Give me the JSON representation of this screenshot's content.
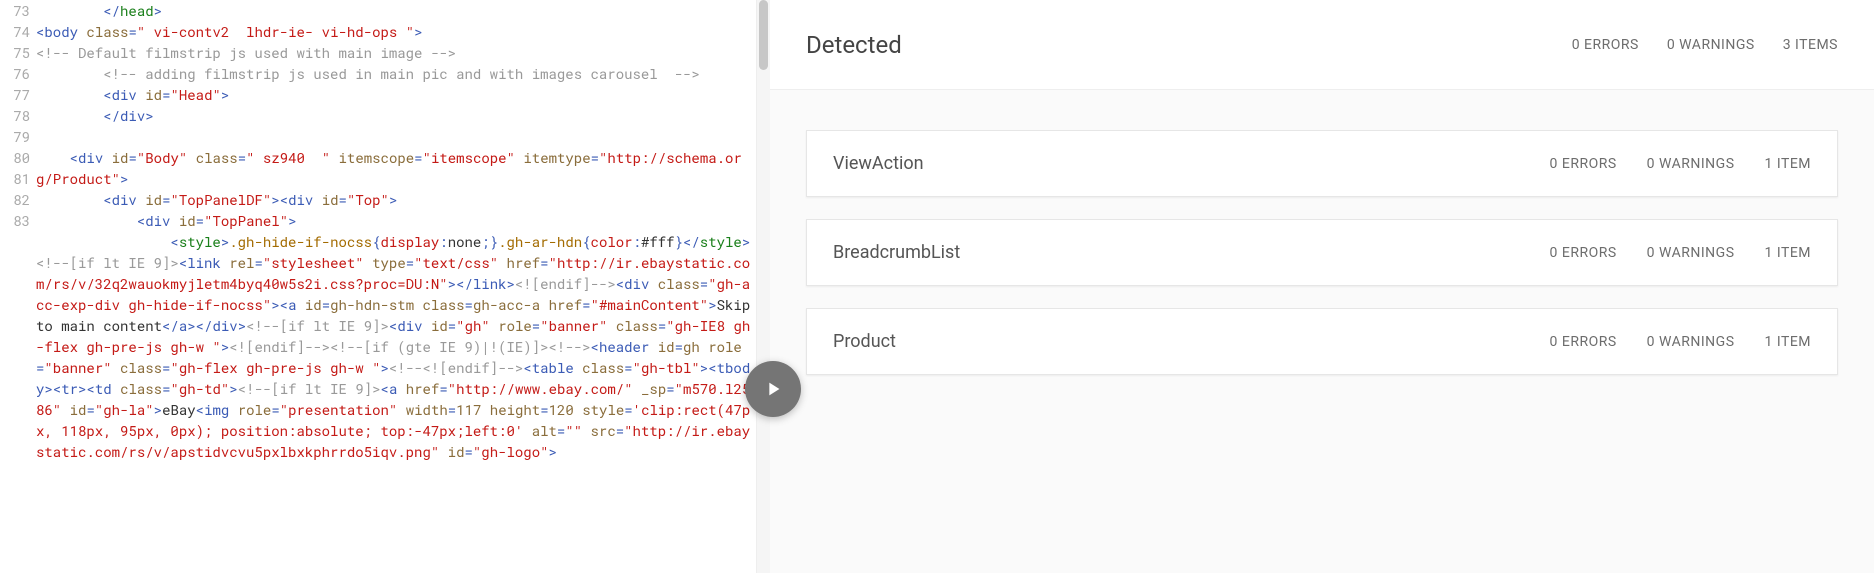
{
  "gutter": {
    "start": 73,
    "end": 83
  },
  "code_lines": [
    [
      {
        "t": "        ",
        "c": ""
      },
      {
        "t": "</",
        "c": "c-pun"
      },
      {
        "t": "head",
        "c": "c-green"
      },
      {
        "t": ">",
        "c": "c-pun"
      }
    ],
    [
      {
        "t": "<",
        "c": "c-pun"
      },
      {
        "t": "body",
        "c": "c-tag"
      },
      {
        "t": " ",
        "c": ""
      },
      {
        "t": "class",
        "c": "c-attr"
      },
      {
        "t": "=",
        "c": "c-pun"
      },
      {
        "t": "\" vi-contv2  lhdr-ie- vi-hd-ops \"",
        "c": "c-str"
      },
      {
        "t": ">",
        "c": "c-pun"
      }
    ],
    [
      {
        "t": "<!-- Default filmstrip js used with main image -->",
        "c": "c-comment"
      }
    ],
    [
      {
        "t": "        ",
        "c": ""
      },
      {
        "t": "<!-- adding filmstrip js used in main pic and with images carousel  -->",
        "c": "c-comment"
      }
    ],
    [
      {
        "t": "        ",
        "c": ""
      },
      {
        "t": "<",
        "c": "c-pun"
      },
      {
        "t": "div",
        "c": "c-tag"
      },
      {
        "t": " ",
        "c": ""
      },
      {
        "t": "id",
        "c": "c-attr"
      },
      {
        "t": "=",
        "c": "c-pun"
      },
      {
        "t": "\"Head\"",
        "c": "c-str"
      },
      {
        "t": ">",
        "c": "c-pun"
      }
    ],
    [
      {
        "t": "        ",
        "c": ""
      },
      {
        "t": "</",
        "c": "c-pun"
      },
      {
        "t": "div",
        "c": "c-tag"
      },
      {
        "t": ">",
        "c": "c-pun"
      }
    ],
    [
      {
        "t": " ",
        "c": ""
      }
    ],
    [
      {
        "t": "    ",
        "c": ""
      },
      {
        "t": "<",
        "c": "c-pun"
      },
      {
        "t": "div",
        "c": "c-tag"
      },
      {
        "t": " ",
        "c": ""
      },
      {
        "t": "id",
        "c": "c-attr"
      },
      {
        "t": "=",
        "c": "c-pun"
      },
      {
        "t": "\"Body\"",
        "c": "c-str"
      },
      {
        "t": " ",
        "c": ""
      },
      {
        "t": "class",
        "c": "c-attr"
      },
      {
        "t": "=",
        "c": "c-pun"
      },
      {
        "t": "\" sz940  \"",
        "c": "c-str"
      },
      {
        "t": " ",
        "c": ""
      },
      {
        "t": "itemscope",
        "c": "c-attr"
      },
      {
        "t": "=",
        "c": "c-pun"
      },
      {
        "t": "\"itemscope\"",
        "c": "c-str"
      },
      {
        "t": " ",
        "c": ""
      },
      {
        "t": "itemtype",
        "c": "c-attr"
      },
      {
        "t": "=",
        "c": "c-pun"
      },
      {
        "t": "\"http://schema.org/Product\"",
        "c": "c-str"
      },
      {
        "t": ">",
        "c": "c-pun"
      }
    ],
    [
      {
        "t": "        ",
        "c": ""
      },
      {
        "t": "<",
        "c": "c-pun"
      },
      {
        "t": "div",
        "c": "c-tag"
      },
      {
        "t": " ",
        "c": ""
      },
      {
        "t": "id",
        "c": "c-attr"
      },
      {
        "t": "=",
        "c": "c-pun"
      },
      {
        "t": "\"TopPanelDF\"",
        "c": "c-str"
      },
      {
        "t": ">",
        "c": "c-pun"
      },
      {
        "t": "<",
        "c": "c-pun"
      },
      {
        "t": "div",
        "c": "c-tag"
      },
      {
        "t": " ",
        "c": ""
      },
      {
        "t": "id",
        "c": "c-attr"
      },
      {
        "t": "=",
        "c": "c-pun"
      },
      {
        "t": "\"Top\"",
        "c": "c-str"
      },
      {
        "t": ">",
        "c": "c-pun"
      }
    ],
    [
      {
        "t": "            ",
        "c": ""
      },
      {
        "t": "<",
        "c": "c-pun"
      },
      {
        "t": "div",
        "c": "c-tag"
      },
      {
        "t": " ",
        "c": ""
      },
      {
        "t": "id",
        "c": "c-attr"
      },
      {
        "t": "=",
        "c": "c-pun"
      },
      {
        "t": "\"TopPanel\"",
        "c": "c-str"
      },
      {
        "t": ">",
        "c": "c-pun"
      }
    ],
    [
      {
        "t": "                ",
        "c": ""
      },
      {
        "t": "<",
        "c": "c-pun"
      },
      {
        "t": "style",
        "c": "c-green"
      },
      {
        "t": ">",
        "c": "c-pun"
      },
      {
        "t": ".gh-hide-if-nocss",
        "c": "c-css-sel"
      },
      {
        "t": "{",
        "c": "c-pun"
      },
      {
        "t": "display",
        "c": "c-css-prop"
      },
      {
        "t": ":",
        "c": "c-pun"
      },
      {
        "t": "none",
        "c": "c-text"
      },
      {
        "t": ";}",
        "c": "c-pun"
      },
      {
        "t": ".gh-ar-hdn",
        "c": "c-css-sel"
      },
      {
        "t": "{",
        "c": "c-pun"
      },
      {
        "t": "color",
        "c": "c-css-prop"
      },
      {
        "t": ":",
        "c": "c-pun"
      },
      {
        "t": "#fff",
        "c": "c-text"
      },
      {
        "t": "}",
        "c": "c-pun"
      },
      {
        "t": "</",
        "c": "c-pun"
      },
      {
        "t": "style",
        "c": "c-green"
      },
      {
        "t": ">",
        "c": "c-pun"
      },
      {
        "t": " ",
        "c": ""
      },
      {
        "t": "<!--[if lt IE 9]>",
        "c": "c-comment"
      },
      {
        "t": "<",
        "c": "c-pun"
      },
      {
        "t": "link",
        "c": "c-tag"
      },
      {
        "t": " ",
        "c": ""
      },
      {
        "t": "rel",
        "c": "c-attr"
      },
      {
        "t": "=",
        "c": "c-pun"
      },
      {
        "t": "\"stylesheet\"",
        "c": "c-str"
      },
      {
        "t": " ",
        "c": ""
      },
      {
        "t": "type",
        "c": "c-attr"
      },
      {
        "t": "=",
        "c": "c-pun"
      },
      {
        "t": "\"text/css\"",
        "c": "c-str"
      },
      {
        "t": " ",
        "c": ""
      },
      {
        "t": "href",
        "c": "c-attr"
      },
      {
        "t": "=",
        "c": "c-pun"
      },
      {
        "t": "\"http://ir.ebaystatic.com/rs/v/32q2wauokmyjletm4byq40w5s2i.css?proc=DU:N\"",
        "c": "c-str"
      },
      {
        "t": ">",
        "c": "c-pun"
      },
      {
        "t": "</",
        "c": "c-pun"
      },
      {
        "t": "link",
        "c": "c-tag"
      },
      {
        "t": ">",
        "c": "c-pun"
      },
      {
        "t": "<![endif]-->",
        "c": "c-comment"
      },
      {
        "t": "<",
        "c": "c-pun"
      },
      {
        "t": "div",
        "c": "c-tag"
      },
      {
        "t": " ",
        "c": ""
      },
      {
        "t": "class",
        "c": "c-attr"
      },
      {
        "t": "=",
        "c": "c-pun"
      },
      {
        "t": "\"gh-acc-exp-div gh-hide-if-nocss\"",
        "c": "c-str"
      },
      {
        "t": ">",
        "c": "c-pun"
      },
      {
        "t": "<",
        "c": "c-pun"
      },
      {
        "t": "a",
        "c": "c-tag"
      },
      {
        "t": " ",
        "c": ""
      },
      {
        "t": "id",
        "c": "c-attr"
      },
      {
        "t": "=",
        "c": "c-pun"
      },
      {
        "t": "gh-hdn-stm",
        "c": "c-attr"
      },
      {
        "t": " ",
        "c": ""
      },
      {
        "t": "class",
        "c": "c-attr"
      },
      {
        "t": "=",
        "c": "c-pun"
      },
      {
        "t": "gh-acc-a",
        "c": "c-attr"
      },
      {
        "t": " ",
        "c": ""
      },
      {
        "t": "href",
        "c": "c-attr"
      },
      {
        "t": "=",
        "c": "c-pun"
      },
      {
        "t": "\"#mainContent\"",
        "c": "c-str"
      },
      {
        "t": ">",
        "c": "c-pun"
      },
      {
        "t": "Skip to main content",
        "c": "c-text"
      },
      {
        "t": "</",
        "c": "c-pun"
      },
      {
        "t": "a",
        "c": "c-tag"
      },
      {
        "t": ">",
        "c": "c-pun"
      },
      {
        "t": "</",
        "c": "c-pun"
      },
      {
        "t": "div",
        "c": "c-tag"
      },
      {
        "t": ">",
        "c": "c-pun"
      },
      {
        "t": "<!--[if lt IE 9]>",
        "c": "c-comment"
      },
      {
        "t": "<",
        "c": "c-pun"
      },
      {
        "t": "div",
        "c": "c-tag"
      },
      {
        "t": " ",
        "c": ""
      },
      {
        "t": "id",
        "c": "c-attr"
      },
      {
        "t": "=",
        "c": "c-pun"
      },
      {
        "t": "\"gh\"",
        "c": "c-str"
      },
      {
        "t": " ",
        "c": ""
      },
      {
        "t": "role",
        "c": "c-attr"
      },
      {
        "t": "=",
        "c": "c-pun"
      },
      {
        "t": "\"banner\"",
        "c": "c-str"
      },
      {
        "t": " ",
        "c": ""
      },
      {
        "t": "class",
        "c": "c-attr"
      },
      {
        "t": "=",
        "c": "c-pun"
      },
      {
        "t": "\"gh-IE8 gh-flex gh-pre-js gh-w \"",
        "c": "c-str"
      },
      {
        "t": ">",
        "c": "c-pun"
      },
      {
        "t": "<![endif]-->",
        "c": "c-comment"
      },
      {
        "t": "<!--[if (gte IE 9)|!(IE)]><!-->",
        "c": "c-comment"
      },
      {
        "t": "<",
        "c": "c-pun"
      },
      {
        "t": "header",
        "c": "c-tag"
      },
      {
        "t": " ",
        "c": ""
      },
      {
        "t": "id",
        "c": "c-attr"
      },
      {
        "t": "=",
        "c": "c-pun"
      },
      {
        "t": "gh",
        "c": "c-attr"
      },
      {
        "t": " ",
        "c": ""
      },
      {
        "t": "role",
        "c": "c-attr"
      },
      {
        "t": "=",
        "c": "c-pun"
      },
      {
        "t": "\"banner\"",
        "c": "c-str"
      },
      {
        "t": " ",
        "c": ""
      },
      {
        "t": "class",
        "c": "c-attr"
      },
      {
        "t": "=",
        "c": "c-pun"
      },
      {
        "t": "\"gh-flex gh-pre-js gh-w \"",
        "c": "c-str"
      },
      {
        "t": ">",
        "c": "c-pun"
      },
      {
        "t": "<!--<![endif]-->",
        "c": "c-comment"
      },
      {
        "t": "<",
        "c": "c-pun"
      },
      {
        "t": "table",
        "c": "c-tag"
      },
      {
        "t": " ",
        "c": ""
      },
      {
        "t": "class",
        "c": "c-attr"
      },
      {
        "t": "=",
        "c": "c-pun"
      },
      {
        "t": "\"gh-tbl\"",
        "c": "c-str"
      },
      {
        "t": ">",
        "c": "c-pun"
      },
      {
        "t": "<",
        "c": "c-pun"
      },
      {
        "t": "tbody",
        "c": "c-tag"
      },
      {
        "t": ">",
        "c": "c-pun"
      },
      {
        "t": "<",
        "c": "c-pun"
      },
      {
        "t": "tr",
        "c": "c-tag"
      },
      {
        "t": ">",
        "c": "c-pun"
      },
      {
        "t": "<",
        "c": "c-pun"
      },
      {
        "t": "td",
        "c": "c-tag"
      },
      {
        "t": " ",
        "c": ""
      },
      {
        "t": "class",
        "c": "c-attr"
      },
      {
        "t": "=",
        "c": "c-pun"
      },
      {
        "t": "\"gh-td\"",
        "c": "c-str"
      },
      {
        "t": ">",
        "c": "c-pun"
      },
      {
        "t": "<!--[if lt IE 9]>",
        "c": "c-comment"
      },
      {
        "t": "<",
        "c": "c-pun"
      },
      {
        "t": "a",
        "c": "c-tag"
      },
      {
        "t": " ",
        "c": ""
      },
      {
        "t": "href",
        "c": "c-attr"
      },
      {
        "t": "=",
        "c": "c-pun"
      },
      {
        "t": "\"http://www.ebay.com/\"",
        "c": "c-str"
      },
      {
        "t": " ",
        "c": ""
      },
      {
        "t": "_sp",
        "c": "c-attr"
      },
      {
        "t": "=",
        "c": "c-pun"
      },
      {
        "t": "\"m570.l2586\"",
        "c": "c-str"
      },
      {
        "t": " ",
        "c": ""
      },
      {
        "t": "id",
        "c": "c-attr"
      },
      {
        "t": "=",
        "c": "c-pun"
      },
      {
        "t": "\"gh-la\"",
        "c": "c-str"
      },
      {
        "t": ">",
        "c": "c-pun"
      },
      {
        "t": "eBay",
        "c": "c-text"
      },
      {
        "t": "<",
        "c": "c-pun"
      },
      {
        "t": "img",
        "c": "c-tag"
      },
      {
        "t": " ",
        "c": ""
      },
      {
        "t": "role",
        "c": "c-attr"
      },
      {
        "t": "=",
        "c": "c-pun"
      },
      {
        "t": "\"presentation\"",
        "c": "c-str"
      },
      {
        "t": " ",
        "c": ""
      },
      {
        "t": "width",
        "c": "c-attr"
      },
      {
        "t": "=",
        "c": "c-pun"
      },
      {
        "t": "117",
        "c": "c-attr"
      },
      {
        "t": " ",
        "c": ""
      },
      {
        "t": "height",
        "c": "c-attr"
      },
      {
        "t": "=",
        "c": "c-pun"
      },
      {
        "t": "120",
        "c": "c-attr"
      },
      {
        "t": " ",
        "c": ""
      },
      {
        "t": "style",
        "c": "c-attr"
      },
      {
        "t": "=",
        "c": "c-pun"
      },
      {
        "t": "'clip:rect(47px, 118px, 95px, 0px); position:absolute; top:-47px;left:0'",
        "c": "c-str"
      },
      {
        "t": " ",
        "c": ""
      },
      {
        "t": "alt",
        "c": "c-attr"
      },
      {
        "t": "=",
        "c": "c-pun"
      },
      {
        "t": "\"\"",
        "c": "c-str"
      },
      {
        "t": " ",
        "c": ""
      },
      {
        "t": "src",
        "c": "c-attr"
      },
      {
        "t": "=",
        "c": "c-pun"
      },
      {
        "t": "\"http://ir.ebaystatic.com/rs/v/apstidvcvu5pxlbxkphrrdo5iqv.png\"",
        "c": "c-str"
      },
      {
        "t": " ",
        "c": ""
      },
      {
        "t": "id",
        "c": "c-attr"
      },
      {
        "t": "=",
        "c": "c-pun"
      },
      {
        "t": "\"gh-logo\"",
        "c": "c-str"
      },
      {
        "t": ">",
        "c": "c-pun"
      }
    ]
  ],
  "results": {
    "title": "Detected",
    "summary": {
      "errors": "0 ERRORS",
      "warnings": "0 WARNINGS",
      "items": "3 ITEMS"
    },
    "groups": [
      {
        "name": "ViewAction",
        "errors": "0 ERRORS",
        "warnings": "0 WARNINGS",
        "items": "1 ITEM"
      },
      {
        "name": "BreadcrumbList",
        "errors": "0 ERRORS",
        "warnings": "0 WARNINGS",
        "items": "1 ITEM"
      },
      {
        "name": "Product",
        "errors": "0 ERRORS",
        "warnings": "0 WARNINGS",
        "items": "1 ITEM"
      }
    ]
  }
}
